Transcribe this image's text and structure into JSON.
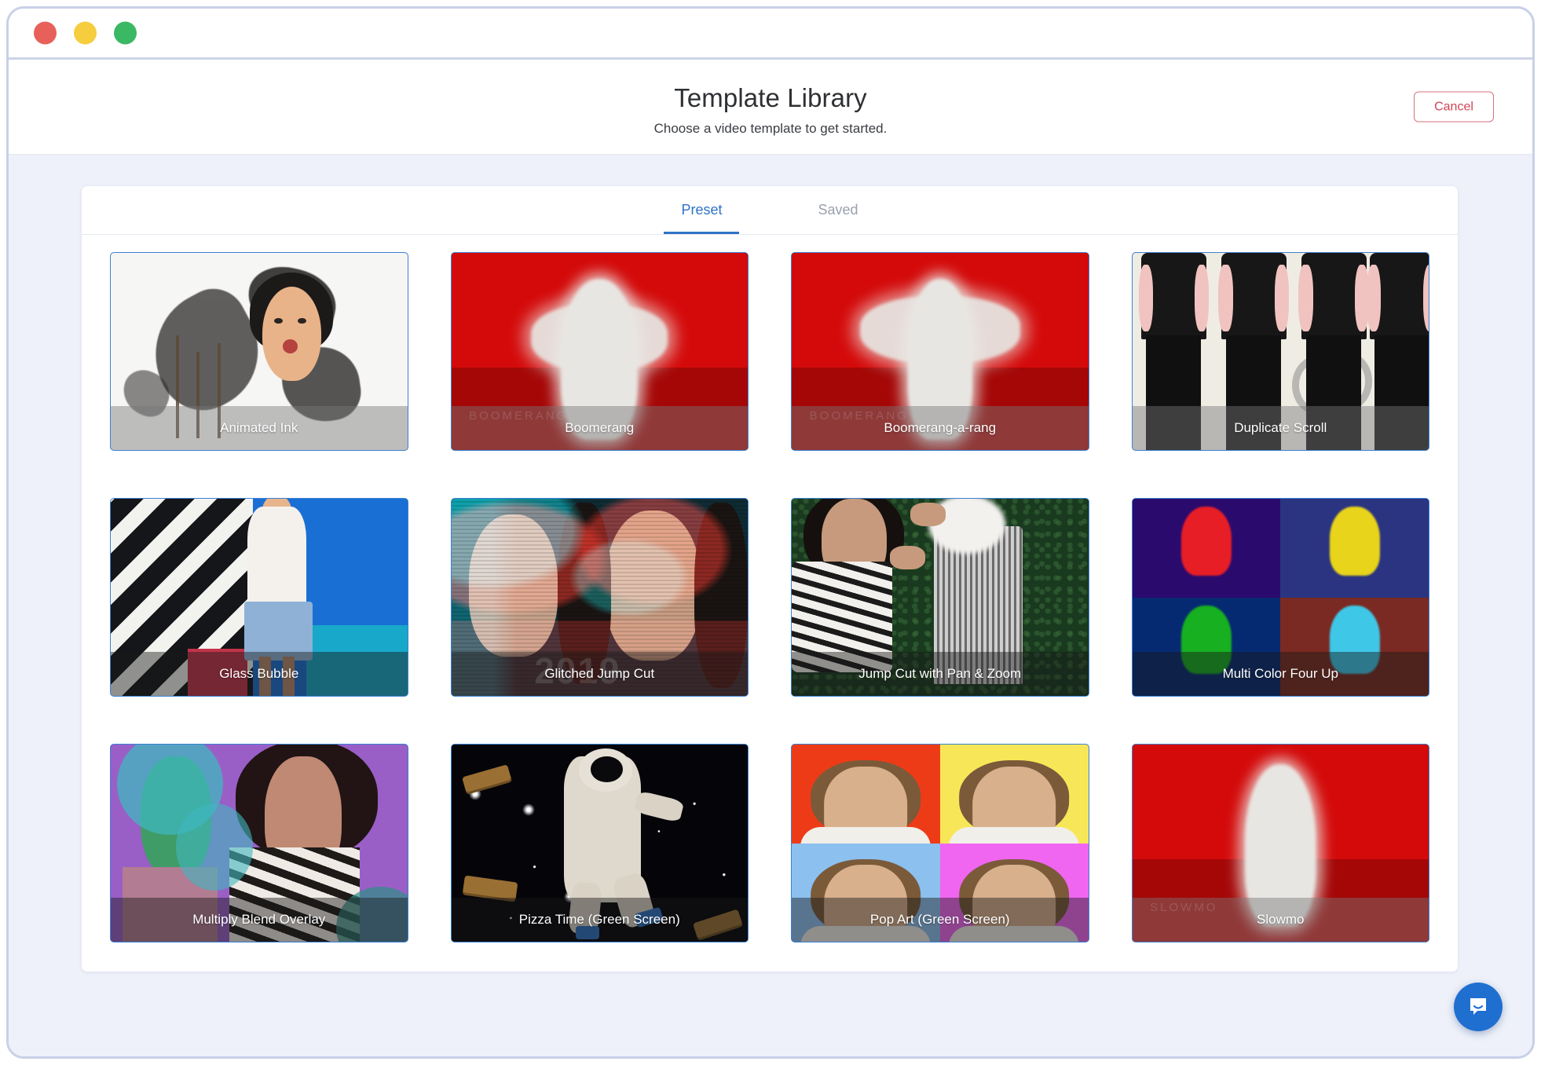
{
  "window": {
    "traffic_lights": [
      {
        "name": "close",
        "color": "#e8605a"
      },
      {
        "name": "minimize",
        "color": "#f5cd3d"
      },
      {
        "name": "maximize",
        "color": "#3bb863"
      }
    ]
  },
  "header": {
    "title": "Template Library",
    "subtitle": "Choose a video template to get started.",
    "cancel_label": "Cancel",
    "cancel_color": "#d14356"
  },
  "tabs": {
    "active": "Preset",
    "accent_color": "#2f72c7",
    "items": [
      {
        "label": "Preset",
        "active": true
      },
      {
        "label": "Saved",
        "active": false
      }
    ]
  },
  "templates": [
    {
      "label": "Animated Ink",
      "art": "ink",
      "band": "gray"
    },
    {
      "label": "Boomerang",
      "art": "red",
      "band": "gray",
      "ghost_text": "BOOMERANG"
    },
    {
      "label": "Boomerang-a-rang",
      "art": "red",
      "band": "gray",
      "ghost_text": "BOOMERANG"
    },
    {
      "label": "Duplicate Scroll",
      "art": "dup",
      "band": "gray"
    },
    {
      "label": "Glass Bubble",
      "art": "glass",
      "band": "dark"
    },
    {
      "label": "Glitched Jump Cut",
      "art": "glitch",
      "band": "dark",
      "overlay_text": "2019"
    },
    {
      "label": "Jump Cut with Pan & Zoom",
      "art": "jump",
      "band": "dark"
    },
    {
      "label": "Multi Color Four Up",
      "art": "four",
      "band": "dark"
    },
    {
      "label": "Multiply Blend Overlay",
      "art": "mult",
      "band": "dark"
    },
    {
      "label": "Pizza Time (Green Screen)",
      "art": "space",
      "band": "dark"
    },
    {
      "label": "Pop Art (Green Screen)",
      "art": "pop",
      "band": "dark"
    },
    {
      "label": "Slowmo",
      "art": "red",
      "band": "gray",
      "ghost_text": "SLOWMO"
    }
  ],
  "intercom": {
    "icon": "chat-bubble-icon",
    "color": "#1f6fd0"
  }
}
